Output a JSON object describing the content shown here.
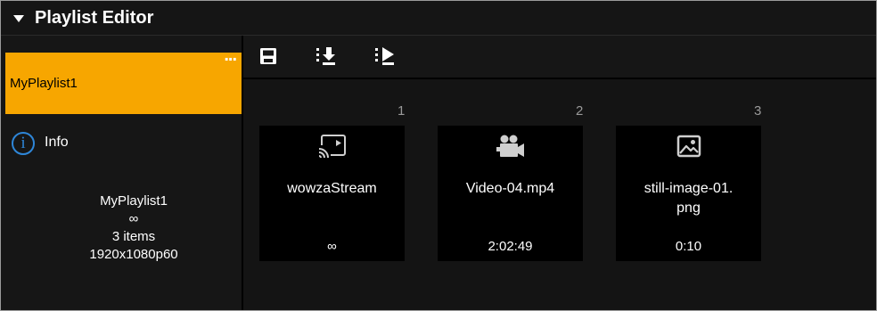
{
  "header": {
    "title": "Playlist Editor"
  },
  "sidebar": {
    "playlist_name": "MyPlaylist1",
    "more_label": "...",
    "info_icon_glyph": "i",
    "info_label": "Info",
    "summary": {
      "name": "MyPlaylist1",
      "loop": "∞",
      "count": "3 items",
      "resolution": "1920x1080p60"
    }
  },
  "toolbar": {
    "buttons": [
      {
        "icon": "save-icon"
      },
      {
        "icon": "import-icon"
      },
      {
        "icon": "play-list-icon"
      }
    ]
  },
  "items": [
    {
      "index": "1",
      "icon": "cast-stream-icon",
      "title": "wowzaStream",
      "duration": "∞"
    },
    {
      "index": "2",
      "icon": "video-camera-icon",
      "title": "Video-04.mp4",
      "duration": "2:02:49"
    },
    {
      "index": "3",
      "icon": "image-icon",
      "title": "still-image-01.\npng",
      "duration": "0:10"
    }
  ],
  "colors": {
    "accent": "#f7a600",
    "info_blue": "#2e86d8",
    "background": "#000000"
  }
}
